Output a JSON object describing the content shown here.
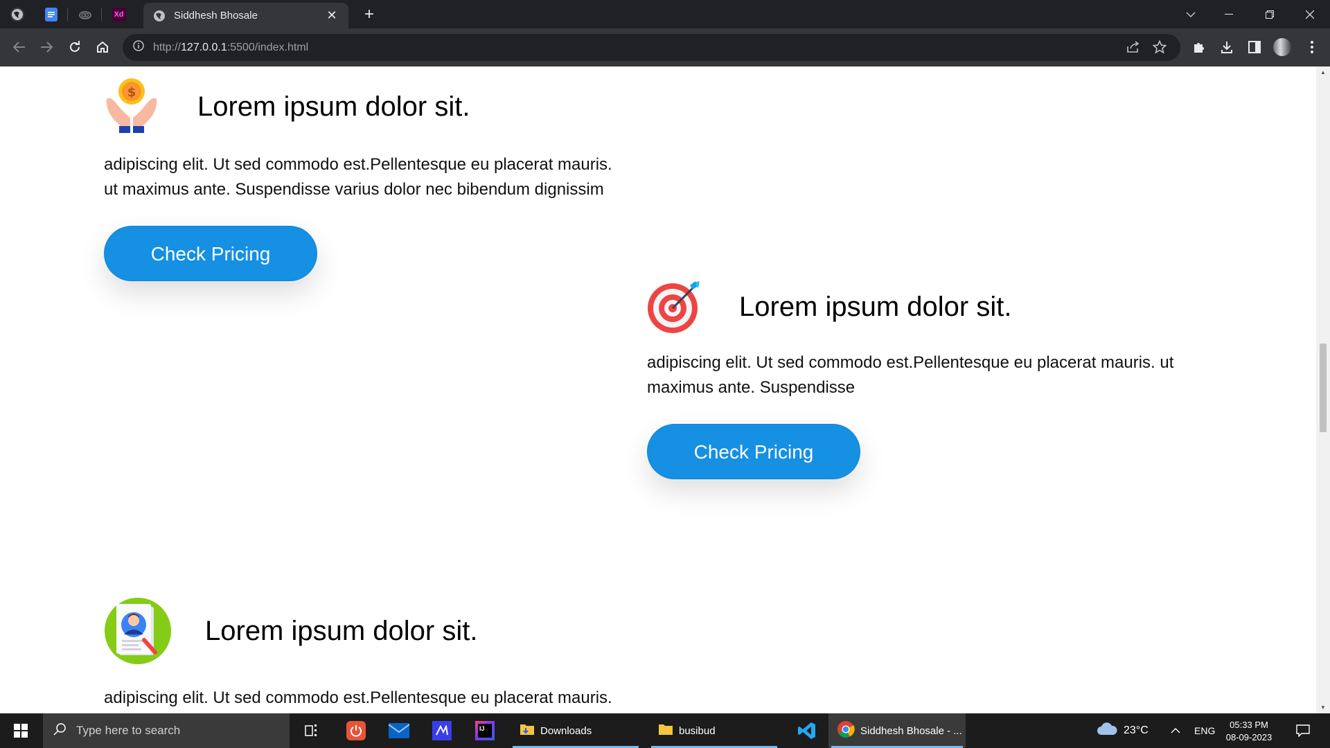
{
  "browser": {
    "active_tab_title": "Siddhesh Bhosale",
    "pinned_tabs": [
      {
        "icon": "globe-icon",
        "color": "#3a3b3f"
      },
      {
        "icon": "docs-icon",
        "color": "#4285f4"
      },
      {
        "icon": "creative-cloud-icon",
        "color": "#3a3b3f"
      },
      {
        "icon": "adobe-xd-icon",
        "color": "#470137",
        "text": "Xd"
      }
    ],
    "url_prefix": "http://",
    "url_host": "127.0.0.1",
    "url_rest": ":5500/index.html"
  },
  "page": {
    "cards": [
      {
        "heading": "Lorem ipsum dolor sit.",
        "body_line1": "adipiscing elit. Ut sed commodo est.Pellentesque eu placerat mauris.",
        "body_line2": "ut maximus ante. Suspendisse varius dolor nec bibendum dignissim",
        "button": "Check Pricing",
        "icon": "hands-coin-icon"
      },
      {
        "heading": "Lorem ipsum dolor sit.",
        "body_line1": "adipiscing elit. Ut sed commodo est.Pellentesque eu placerat mauris. ut",
        "body_line2": "maximus ante. Suspendisse",
        "button": "Check Pricing",
        "icon": "target-icon"
      },
      {
        "heading": "Lorem ipsum dolor sit.",
        "body_line1": "adipiscing elit. Ut sed commodo est.Pellentesque eu placerat mauris.",
        "icon": "profile-search-icon"
      }
    ]
  },
  "taskbar": {
    "search_placeholder": "Type here to search",
    "apps": [
      {
        "label": "Downloads",
        "icon": "folder-icon"
      },
      {
        "label": "busibud",
        "icon": "folder-icon"
      },
      {
        "label": "Siddhesh Bhosale - ...",
        "icon": "chrome-icon"
      }
    ],
    "weather": "23°C",
    "language": "ENG",
    "time": "05:33 PM",
    "date": "08-09-2023"
  },
  "colors": {
    "button": "#1590e3",
    "chrome_dark": "#202124",
    "chrome_toolbar": "#35363a",
    "taskbar": "#1c1c1c"
  }
}
